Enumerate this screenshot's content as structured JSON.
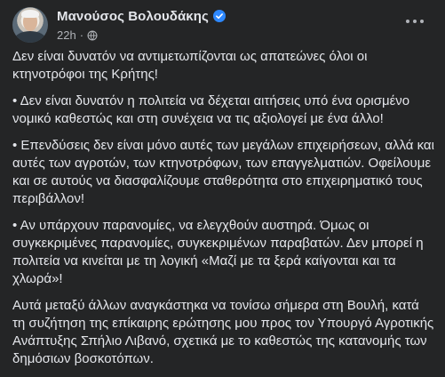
{
  "post": {
    "author": "Μανούσος Βολουδάκης",
    "time": "22h",
    "separator": "·",
    "paragraphs": [
      "Δεν είναι δυνατόν να αντιμετωπίζονται ως απατεώνες όλοι οι κτηνοτρόφοι της Κρήτης!",
      "• Δεν είναι δυνατόν η πολιτεία να δέχεται αιτήσεις υπό ένα ορισμένο νομικό καθεστώς και στη συνέχεια να τις αξιολογεί με ένα άλλο!",
      "• Επενδύσεις δεν είναι μόνο αυτές των μεγάλων επιχειρήσεων, αλλά και αυτές των αγροτών, των κτηνοτρόφων, των επαγγελματιών. Οφείλουμε και σε αυτούς να διασφαλίζουμε σταθερότητα στο επιχειρηματικό τους περιβάλλον!",
      "• Αν υπάρχουν παρανομίες, να ελεγχθούν αυστηρά. Όμως οι συγκεκριμένες παρανομίες, συγκεκριμένων παραβατών. Δεν μπορεί η πολιτεία να κινείται με τη λογική «Μαζί με τα ξερά καίγονται και τα χλωρά»!",
      "Αυτά μεταξύ άλλων αναγκάστηκα να τονίσω σήμερα στη Βουλή, κατά τη συζήτηση της επίκαιρης ερώτησης μου προς τον Υπουργό Αγροτικής Ανάπτυξης Σπήλιο Λιβανό, σχετικά με το καθεστώς της κατανομής των δημόσιων βοσκοτόπων."
    ]
  },
  "colors": {
    "background": "#242526",
    "text": "#e4e6eb",
    "secondary": "#b0b3b8",
    "verified": "#2d88ff"
  },
  "icons": {
    "verified": "verified-badge-icon",
    "audience": "globe-icon",
    "more": "more-options-icon"
  }
}
